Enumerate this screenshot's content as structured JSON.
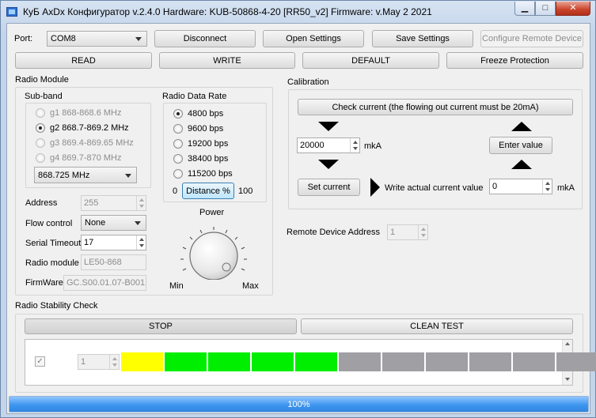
{
  "window": {
    "title": "КуБ AxDx Конфигуратор v.2.4.0   Hardware: KUB-50868-4-20 [RR50_v2]   Firmware: v.May  2 2021",
    "minimize": "▁",
    "maximize": "□",
    "close": "✕"
  },
  "top": {
    "port_label": "Port:",
    "port_value": "COM8",
    "disconnect": "Disconnect",
    "open_settings": "Open Settings",
    "save_settings": "Save Settings",
    "configure_remote": "Configure Remote Device",
    "read": "READ",
    "write": "WRITE",
    "default": "DEFAULT",
    "freeze": "Freeze Protection"
  },
  "radio_module": {
    "title": "Radio Module",
    "subband_title": "Sub-band",
    "subbands": [
      {
        "label": "g1 868-868.6 MHz"
      },
      {
        "label": "g2 868.7-869.2 MHz"
      },
      {
        "label": "g3 869.4-869.65 MHz"
      },
      {
        "label": "g4 869.7-870 MHz"
      }
    ],
    "frequency": "868.725 MHz",
    "data_rate_title": "Radio Data Rate",
    "rates": [
      {
        "label": "4800 bps"
      },
      {
        "label": "9600 bps"
      },
      {
        "label": "19200 bps"
      },
      {
        "label": "38400 bps"
      },
      {
        "label": "115200 bps"
      }
    ],
    "distance_min": "0",
    "distance_button": "Distance %",
    "distance_max": "100",
    "power_label": "Power",
    "power_min": "Min",
    "power_max": "Max",
    "address_label": "Address",
    "address_value": "255",
    "flow_label": "Flow control",
    "flow_value": "None",
    "timeout_label": "Serial Timeout",
    "timeout_value": "17",
    "module_label": "Radio module",
    "module_value": "LE50-868",
    "firmware_label": "FirmWare",
    "firmware_value": "GC.S00.01.07-B001"
  },
  "calibration": {
    "title": "Calibration",
    "check_current": "Check current (the flowing out current must be 20mA)",
    "input_value": "20000",
    "unit1": "mkA",
    "enter_value": "Enter value",
    "set_current": "Set current",
    "write_label": "Write actual current value",
    "actual_value": "0",
    "unit2": "mkA"
  },
  "remote": {
    "label": "Remote Device Address",
    "value": "1"
  },
  "stability": {
    "title": "Radio Stability Check",
    "stop": "STOP",
    "clean": "CLEAN TEST",
    "checkbox": "✓",
    "row_value": "1",
    "cells": [
      "#ffff00",
      "#00ee00",
      "#00ee00",
      "#00ee00",
      "#00ee00",
      "#a0a0a4",
      "#a0a0a4",
      "#a0a0a4",
      "#a0a0a4",
      "#a0a0a4",
      "#a0a0a4"
    ]
  },
  "progress": {
    "label": "100%",
    "value": 1.0
  }
}
